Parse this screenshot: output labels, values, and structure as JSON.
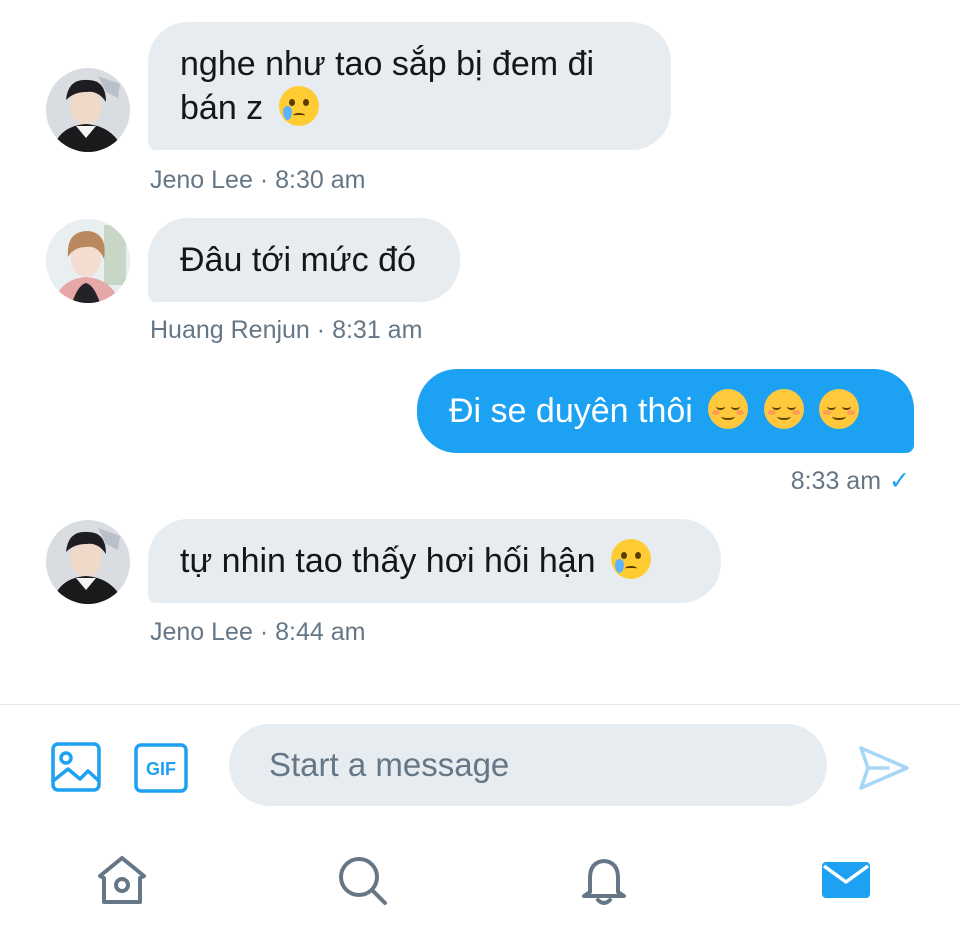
{
  "messages": [
    {
      "direction": "in",
      "sender": "Jeno Lee",
      "time": "8:30 am",
      "lines": [
        "nghe như tao sắp bị đem đi",
        "bán z"
      ],
      "emoji": "crying-face-emoji"
    },
    {
      "direction": "in",
      "sender": "Huang Renjun",
      "time": "8:31 am",
      "text": "Đâu tới mức đó"
    },
    {
      "direction": "out",
      "time": "8:33 am",
      "text": "Đi se duyên thôi",
      "emoji": "smiling-face-emoji",
      "status_icon": "check-icon"
    },
    {
      "direction": "in",
      "sender": "Jeno Lee",
      "time": "8:44 am",
      "text": "tự nhin tao thấy hơi hối hận",
      "emoji": "crying-face-emoji"
    }
  ],
  "meta_separator": "·",
  "check_glyph": "✓",
  "composer": {
    "placeholder": "Start a message",
    "media_icon": "image-icon",
    "gif_label": "GIF",
    "send_icon": "send-icon"
  },
  "tabs": [
    "home-icon",
    "search-icon",
    "bell-icon",
    "mail-icon"
  ],
  "colors": {
    "accent": "#1da1f2",
    "bubble_in": "#e6ecf0",
    "meta_text": "#657786",
    "icon_gray": "#657786",
    "send_disabled": "#a8d6f7"
  }
}
